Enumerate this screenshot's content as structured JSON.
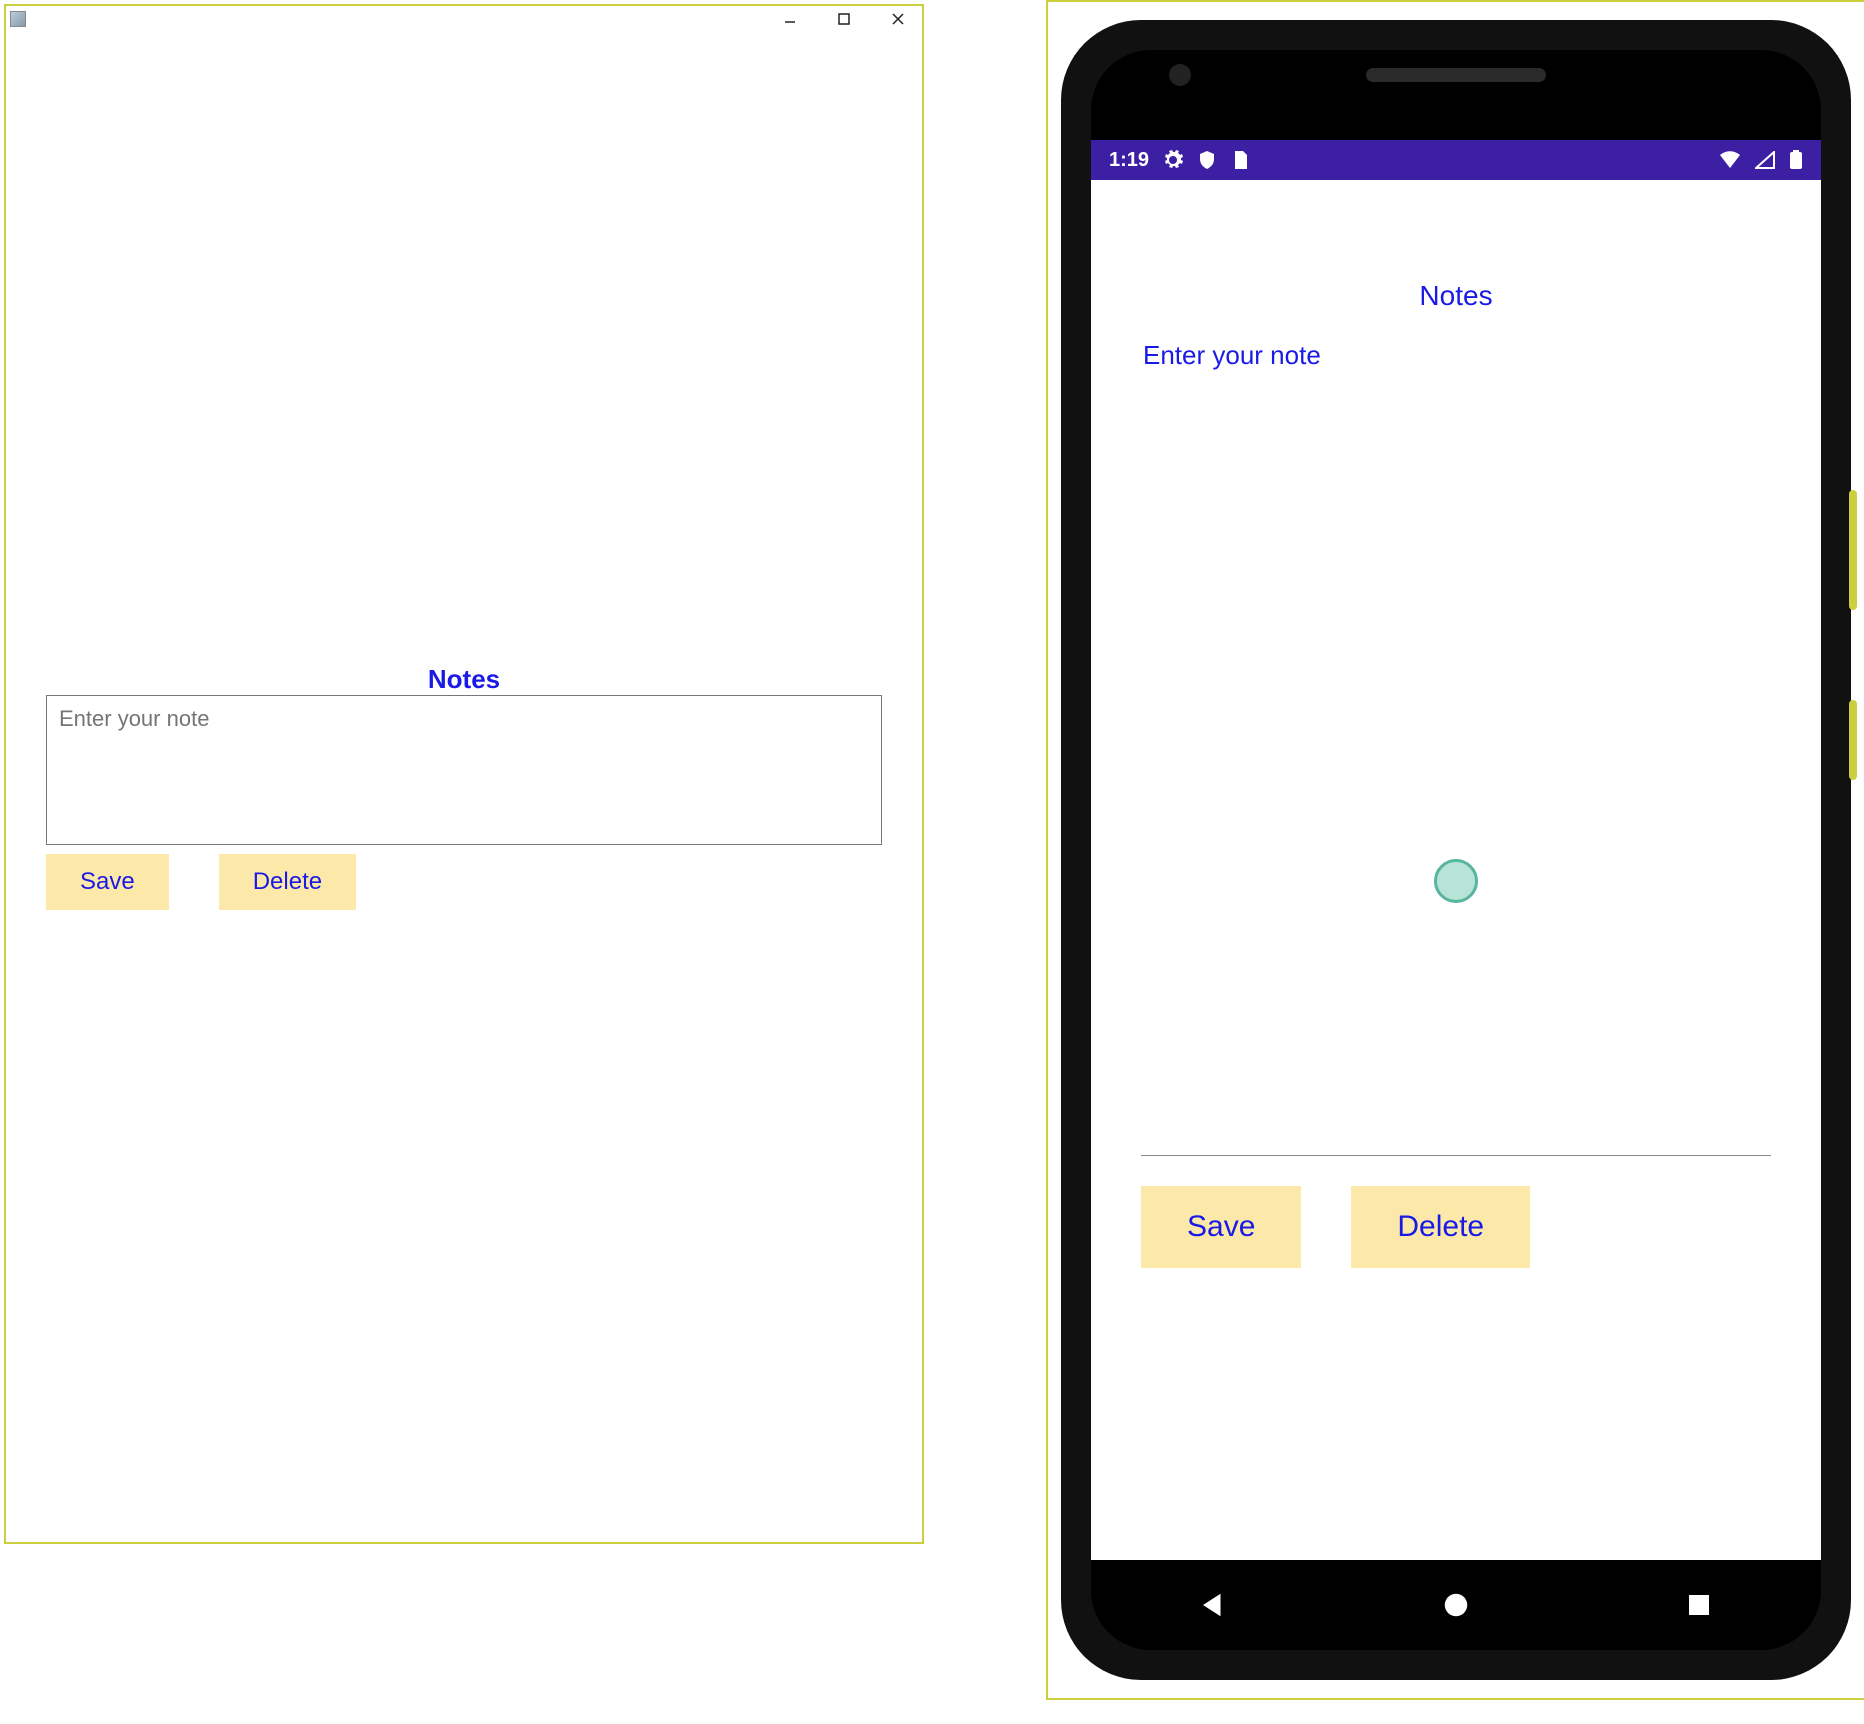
{
  "desktop": {
    "notes_title": "Notes",
    "note_placeholder": "Enter your note",
    "save_label": "Save",
    "delete_label": "Delete"
  },
  "phone": {
    "status": {
      "time": "1:19"
    },
    "notes_title": "Notes",
    "note_placeholder": "Enter your note",
    "save_label": "Save",
    "delete_label": "Delete"
  },
  "colors": {
    "accent_text": "#1a1ae6",
    "button_bg": "#fce9a9",
    "frame_highlight": "#cbcf3e",
    "statusbar_bg": "#3d1fa3"
  }
}
